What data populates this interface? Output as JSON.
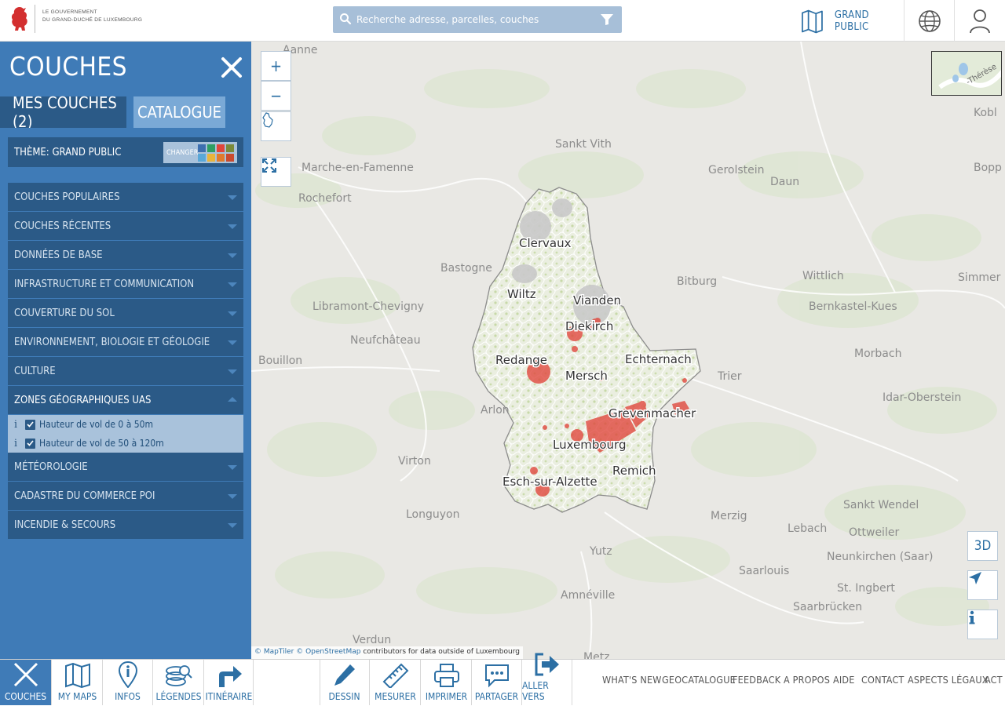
{
  "header": {
    "gov_line1": "LE GOUVERNEMENT",
    "gov_line2": "DU GRAND-DUCHÉ DE LUXEMBOURG",
    "search_placeholder": "Recherche adresse, parcelles, couches",
    "theme_label": "GRAND PUBLIC",
    "icons": {
      "logo": "lion-crest-icon",
      "search": "search-icon",
      "filter": "filter-icon",
      "theme": "map-icon",
      "language": "globe-icon",
      "user": "user-icon"
    }
  },
  "sidebar": {
    "title": "COUCHES",
    "tabs": [
      {
        "label": "MES COUCHES (2)"
      },
      {
        "label": "CATALOGUE",
        "active": true
      }
    ],
    "theme_label": "THÈME: GRAND PUBLIC",
    "change_label": "CHANGER",
    "swatch_colors": [
      "#3d6fb0",
      "#2f9e63",
      "#e0453a",
      "#7a8a3a",
      "#59a8d8",
      "#e8b43c",
      "#e07a2d",
      "#c94a2f"
    ],
    "categories": [
      {
        "label": "COUCHES POPULAIRES"
      },
      {
        "label": "COUCHES RÉCENTES"
      },
      {
        "label": "DONNÉES DE BASE"
      },
      {
        "label": "INFRASTRUCTURE ET COMMUNICATION"
      },
      {
        "label": "COUVERTURE DU SOL"
      },
      {
        "label": "ENVIRONNEMENT, BIOLOGIE ET GÉOLOGIE"
      },
      {
        "label": "CULTURE"
      },
      {
        "label": "ZONES GÉOGRAPHIQUES UAS",
        "expanded": true,
        "layers": [
          {
            "label": "Hauteur de vol de 0 à 50m",
            "checked": true
          },
          {
            "label": "Hauteur de vol de 50 à 120m",
            "checked": true
          }
        ]
      },
      {
        "label": "MÉTÉOROLOGIE"
      },
      {
        "label": "CADASTRE DU COMMERCE POI"
      },
      {
        "label": "INCENDIE & SECOURS"
      }
    ]
  },
  "map": {
    "zoom_in": "+",
    "zoom_out": "−",
    "btn_3d": "3D",
    "attribution_maptiler": "© MapTiler",
    "attribution_osm": "© OpenStreetMap",
    "attribution_rest": "contributors for data outside of Luxembourg",
    "minimap_label": "-Thérèse",
    "places": [
      "Clervaux",
      "Wiltz",
      "Vianden",
      "Diekirch",
      "Redange",
      "Mersch",
      "Echternach",
      "Grevenmacher",
      "Luxembourg",
      "Remich",
      "Esch-sur-Alzette"
    ],
    "outside_places": [
      "Aanne",
      "Sankt Vith",
      "Marche-en-Famenne",
      "Rochefort",
      "Gerolstein",
      "Daun",
      "Bastogne",
      "Bitburg",
      "Wittlich",
      "Libramont-Chevigny",
      "Bernkastel-Kues",
      "Neufchâteau",
      "Bouillon",
      "Trier",
      "Morbach",
      "Arlon",
      "Idar-Oberstein",
      "Virton",
      "Longuyon",
      "Merzig",
      "Sankt Wendel",
      "Lebach",
      "Ottweiler",
      "Yutz",
      "Neunkirchen (Saar)",
      "Saarlouis",
      "St. Ingbert",
      "Amnéville",
      "Saarbrücken",
      "Verdun",
      "Metz",
      "Kobl",
      "Bopp",
      "Simmer"
    ],
    "uas_zone_color": "#e0453a"
  },
  "footer": {
    "buttons": [
      {
        "label": "COUCHES",
        "icon": "close-icon"
      },
      {
        "label": "MY MAPS",
        "icon": "book-map-icon"
      },
      {
        "label": "INFOS",
        "icon": "info-pin-icon"
      },
      {
        "label": "LÉGENDES",
        "icon": "legend-icon"
      },
      {
        "label": "ITINÉRAIRE",
        "icon": "route-arrow-icon"
      },
      {
        "label": "DESSIN",
        "icon": "pencil-icon"
      },
      {
        "label": "MESURER",
        "icon": "ruler-icon"
      },
      {
        "label": "IMPRIMER",
        "icon": "printer-icon"
      },
      {
        "label": "PARTAGER",
        "icon": "share-bubble-icon"
      },
      {
        "label": "ALLER VERS",
        "icon": "go-to-icon"
      }
    ],
    "links": [
      "WHAT'S NEW",
      "GEOCATALOGUE",
      "FEEDBACK",
      "A PROPOS",
      "AIDE",
      "CONTACT",
      "ASPECTS LÉGAUX",
      "ACT"
    ]
  }
}
